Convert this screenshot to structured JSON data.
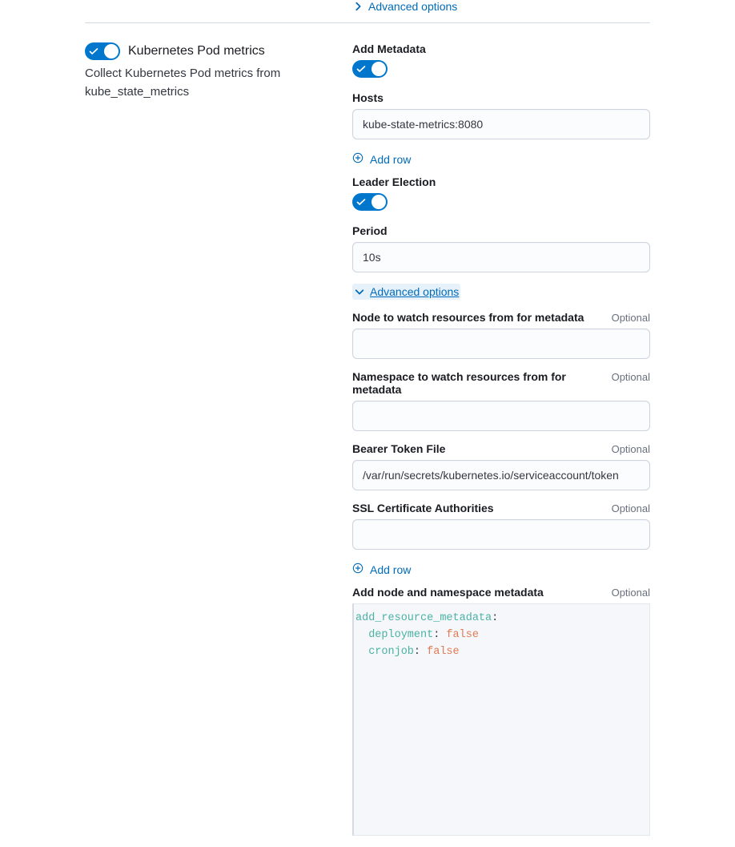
{
  "top": {
    "advanced_label": "Advanced options"
  },
  "left": {
    "toggle_title": "Kubernetes Pod metrics",
    "desc": "Collect Kubernetes Pod metrics from kube_state_metrics"
  },
  "form": {
    "add_metadata_label": "Add Metadata",
    "hosts_label": "Hosts",
    "hosts_value": "kube-state-metrics:8080",
    "add_row_label": "Add row",
    "leader_label": "Leader Election",
    "period_label": "Period",
    "period_value": "10s",
    "advanced_label": "Advanced options",
    "node_watch_label": "Node to watch resources from for metadata",
    "node_watch_value": "",
    "namespace_watch_label": "Namespace to watch resources from for metadata",
    "namespace_watch_value": "",
    "bearer_label": "Bearer Token File",
    "bearer_value": "/var/run/secrets/kubernetes.io/serviceaccount/token",
    "ssl_label": "SSL Certificate Authorities",
    "ssl_value": "",
    "add_node_ns_label": "Add node and namespace metadata",
    "optional_label": "Optional",
    "yaml": {
      "k1": "add_resource_metadata",
      "k2": "deployment",
      "v2": "false",
      "k3": "cronjob",
      "v3": "false"
    }
  }
}
